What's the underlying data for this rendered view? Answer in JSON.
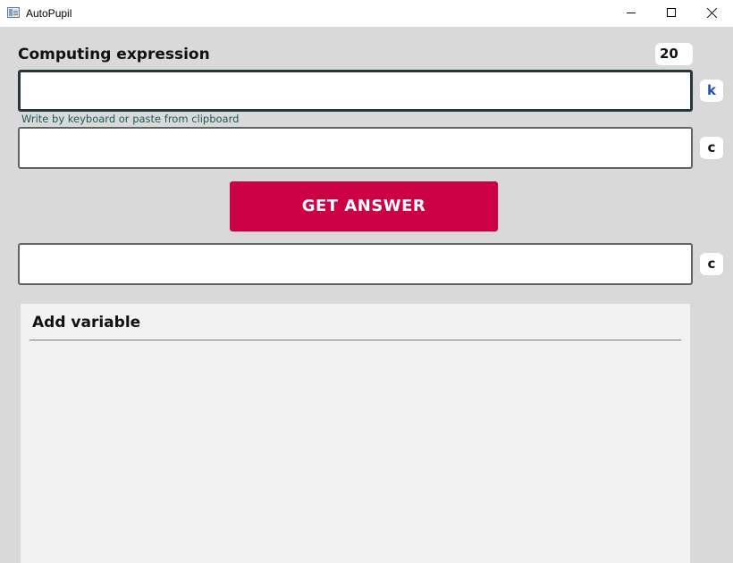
{
  "window": {
    "title": "AutoPupil",
    "icon": "app-window-icon",
    "controls": [
      "minimize-icon",
      "maximize-icon",
      "close-icon"
    ]
  },
  "expression": {
    "title": "Computing expression",
    "counter": "20",
    "input_value": "",
    "hint": "Write by keyboard or paste from clipboard",
    "keyboard_button_label": "k",
    "second_input_value": "",
    "clear_button_label": "c"
  },
  "action": {
    "get_answer_label": "GET ANSWER"
  },
  "answer": {
    "value": "",
    "clear_button_label": "c"
  },
  "variables": {
    "title": "Add variable"
  },
  "colors": {
    "background": "#d9d9d9",
    "accent_button": "#cc0044",
    "hint_text": "#1c5a58",
    "keyboard_label": "#1f4fbf"
  }
}
